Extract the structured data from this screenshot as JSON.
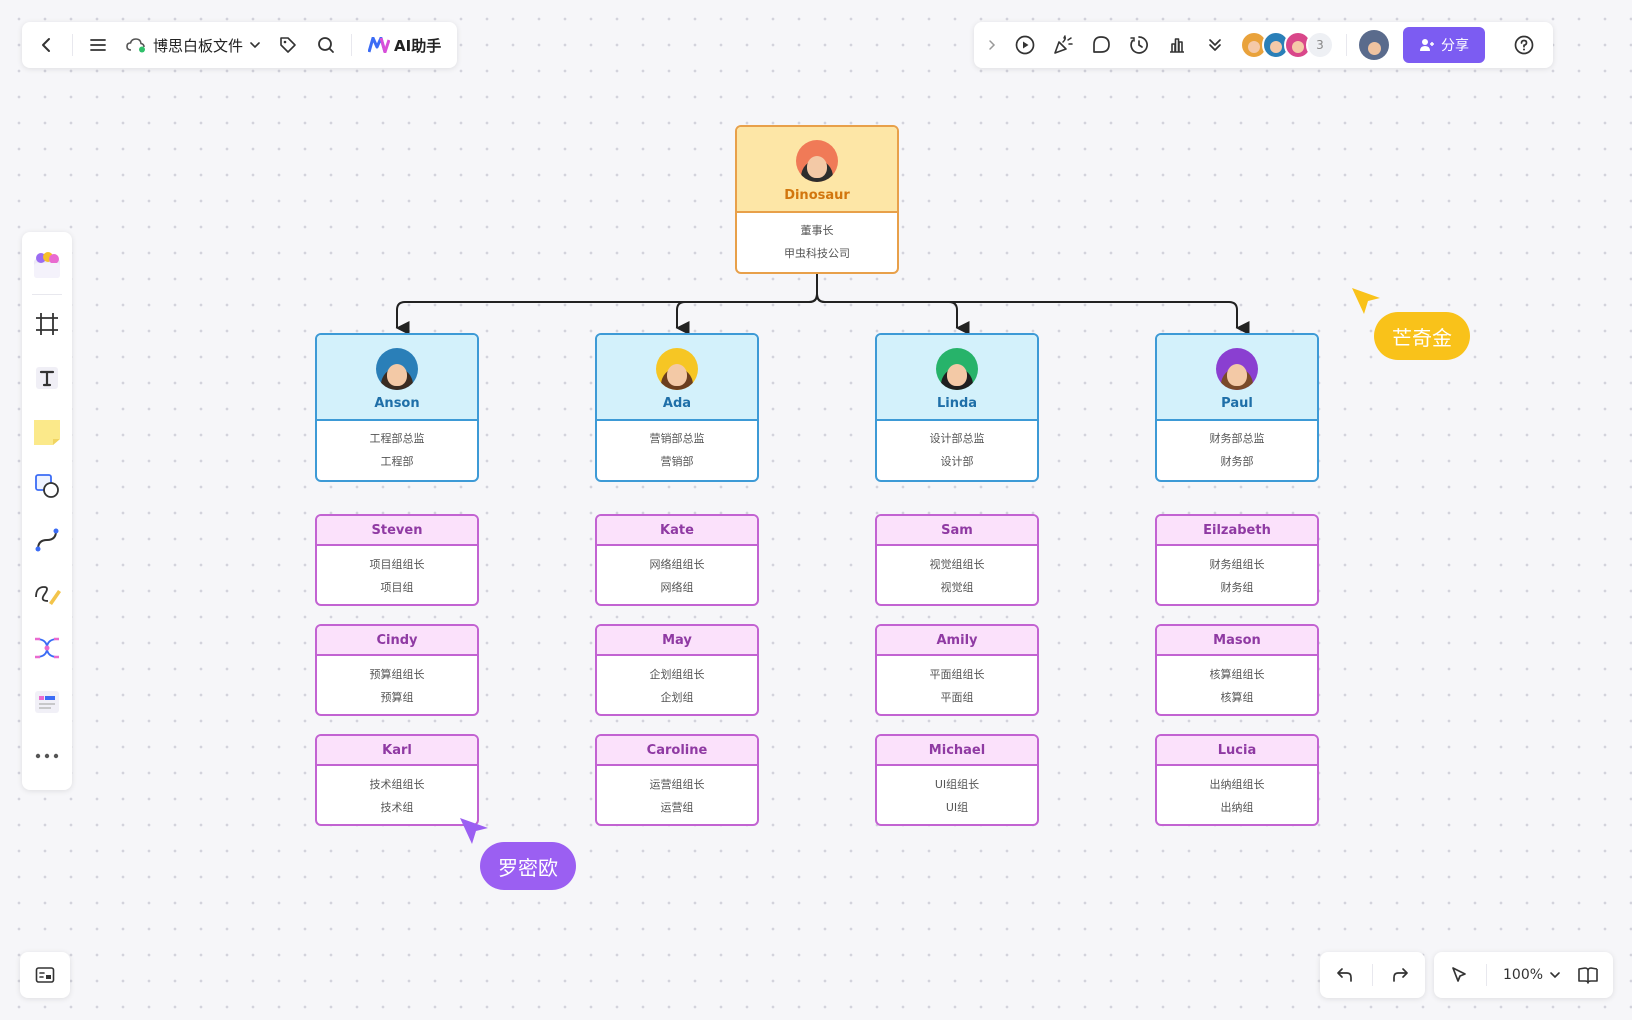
{
  "toolbar_top_left": {
    "doc_name": "博思白板文件",
    "ai_label": "AI助手"
  },
  "toolbar_top_right": {
    "collaborator_count": "3",
    "share_label": "分享"
  },
  "zoom": {
    "level": "100%"
  },
  "org": {
    "top": {
      "name": "Dinosaur",
      "title": "董事长",
      "company": "甲虫科技公司"
    },
    "managers": [
      {
        "name": "Anson",
        "title": "工程部总监",
        "dept": "工程部"
      },
      {
        "name": "Ada",
        "title": "营销部总监",
        "dept": "营销部"
      },
      {
        "name": "Linda",
        "title": "设计部总监",
        "dept": "设计部"
      },
      {
        "name": "Paul",
        "title": "财务部总监",
        "dept": "财务部"
      }
    ],
    "leads": [
      [
        {
          "name": "Steven",
          "title": "项目组组长",
          "group": "项目组"
        },
        {
          "name": "Cindy",
          "title": "预算组组长",
          "group": "预算组"
        },
        {
          "name": "Karl",
          "title": "技术组组长",
          "group": "技术组"
        }
      ],
      [
        {
          "name": "Kate",
          "title": "网络组组长",
          "group": "网络组"
        },
        {
          "name": "May",
          "title": "企划组组长",
          "group": "企划组"
        },
        {
          "name": "Caroline",
          "title": "运营组组长",
          "group": "运营组"
        }
      ],
      [
        {
          "name": "Sam",
          "title": "视觉组组长",
          "group": "视觉组"
        },
        {
          "name": "Amily",
          "title": "平面组组长",
          "group": "平面组"
        },
        {
          "name": "Michael",
          "title": "UI组组长",
          "group": "UI组"
        }
      ],
      [
        {
          "name": "Eilzabeth",
          "title": "财务组组长",
          "group": "财务组"
        },
        {
          "name": "Mason",
          "title": "核算组组长",
          "group": "核算组"
        },
        {
          "name": "Lucia",
          "title": "出纳组组长",
          "group": "出纳组"
        }
      ]
    ]
  },
  "cursors": [
    {
      "name": "芒奇金",
      "color": "#f9c21a"
    },
    {
      "name": "罗密欧",
      "color": "#9b5ff2"
    }
  ],
  "colors": {
    "accent": "#7c5cf2",
    "top_border": "#e8a04a",
    "manager_border": "#3d9ad6",
    "lead_border": "#c263d2"
  }
}
